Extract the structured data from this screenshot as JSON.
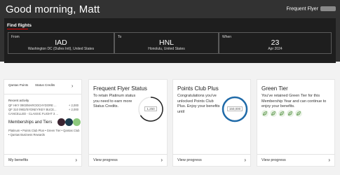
{
  "header": {
    "greeting": "Good morning, Matt",
    "frequent_flyer": "Frequent Flyer"
  },
  "find_flights": {
    "title": "Find flights",
    "from": {
      "label": "From",
      "code": "IAD",
      "airport": "Washington DC (Dulles Intl), United States"
    },
    "to": {
      "label": "To",
      "code": "HNL",
      "airport": "Honolulu, United States"
    },
    "when": {
      "label": "When",
      "day": "23",
      "month": "Apr 2024"
    }
  },
  "account_card": {
    "tab_points": "Qantas Points",
    "tab_status": "Status Credits",
    "recent_label": "Recent activity",
    "activity": [
      {
        "desc": "QF HKY 0903/MAROOCHYDORE ...",
        "amount": "+ 2,000"
      },
      {
        "desc": "QF 310 0902/SYDNEY/KEY BUCE...",
        "amount": "+ 2,000"
      },
      {
        "desc": "CANCELLED - CLASSIC FLIGHT 3 ...",
        "amount": ""
      }
    ],
    "memberships_title": "Memberships and Tiers",
    "tiers_text": "Platinum • Points Club Plus • Green Tier • Qantas Club • Qantas Business Rewards",
    "footer": "My benefits"
  },
  "status_card": {
    "title": "Frequent Flyer Status",
    "body": "To retain Platinum status you need to earn      more Status Credits.",
    "ring_value": "1,250",
    "footer": "View progress"
  },
  "points_card": {
    "title": "Points Club Plus",
    "body": "Congratulations you've unlocked Points Club Plus. Enjoy your benefits until",
    "ring_value": "150,000",
    "footer": "View progress"
  },
  "green_card": {
    "title": "Green Tier",
    "body": "You've retained Green Tier for this Membership Year and can continue to enjoy your benefits.",
    "leaves": [
      "leaf-icon",
      "leaf-icon",
      "leaf-icon",
      "leaf-icon",
      "leaf-icon"
    ],
    "footer": "View progress"
  },
  "colors": {
    "header_bg": "#323232",
    "accent_red": "#e40000",
    "status_ring": "#222222",
    "points_ring": "#1f6aa8",
    "green": "#4c8c3a"
  }
}
